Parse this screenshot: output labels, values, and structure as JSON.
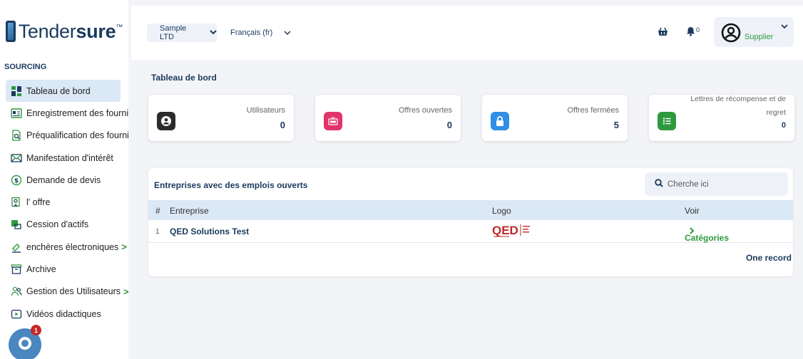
{
  "brand": {
    "name_regular": "Tender",
    "name_bold": "sure",
    "tm": "™"
  },
  "sidebar": {
    "section": "SOURCING",
    "items": [
      {
        "label": "Tableau de bord",
        "icon": "dashboard-icon",
        "active": true
      },
      {
        "label": "Enregistrement des fournisseurs",
        "icon": "id-card-icon"
      },
      {
        "label": "Préqualification des fournisseurs",
        "icon": "document-search-icon"
      },
      {
        "label": "Manifestation d'intérêt",
        "icon": "envelope-icon"
      },
      {
        "label": "Demande de devis",
        "icon": "dollar-circle-icon"
      },
      {
        "label": "l' offre",
        "icon": "tender-icon"
      },
      {
        "label": "Cession d'actifs",
        "icon": "asset-icon"
      },
      {
        "label": "enchères électroniques",
        "icon": "gavel-icon",
        "chevron": ">"
      },
      {
        "label": "Archive",
        "icon": "archive-icon"
      },
      {
        "label": "Gestion des Utilisateurs",
        "icon": "users-icon",
        "chevron": ">"
      },
      {
        "label": "Vidéos didactiques",
        "icon": "play-icon"
      }
    ]
  },
  "topbar": {
    "company": "Sample LTD",
    "language": "Français (fr)",
    "notifications": "0",
    "role": "Supplier"
  },
  "main": {
    "title": "Tableau de bord",
    "stats": [
      {
        "label": "Utilisateurs",
        "value": "0",
        "icon": "user-circle-icon",
        "color": "#2b2b2b"
      },
      {
        "label": "Offres ouvertes",
        "value": "0",
        "icon": "live-icon",
        "color": "#e0356a"
      },
      {
        "label": "Offres fermées",
        "value": "5",
        "icon": "lock-icon",
        "color": "#2f8ee5"
      },
      {
        "label": "Lettres de récompense et de regret",
        "value": "0",
        "icon": "list-icon",
        "color": "#2e9a3e"
      }
    ],
    "panel": {
      "title": "Entreprises avec des emplois ouverts",
      "search_placeholder": "Cherche ici",
      "columns": {
        "num": "#",
        "company": "Entreprise",
        "logo": "Logo",
        "view": "Voir"
      },
      "rows": [
        {
          "num": "1",
          "company": "QED Solutions Test",
          "logo_text": "QED",
          "view": "Catégories"
        }
      ],
      "record_count": "One record"
    }
  },
  "chat": {
    "badge": "1"
  },
  "colors": {
    "navy": "#1b3a5e",
    "green": "#2e9a3e",
    "highlight": "#dbe8f5"
  }
}
